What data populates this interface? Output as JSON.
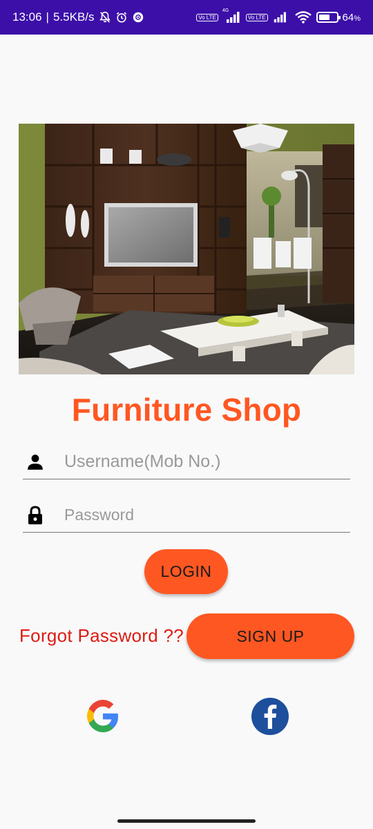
{
  "status_bar": {
    "time": "13:06",
    "network_speed": "5.5KB/s",
    "battery": "64",
    "battery_unit": "%",
    "battery_level": 0.64,
    "volte_label": "Vo LTE",
    "network_type": "4G",
    "icons": [
      "mute-icon",
      "alarm-icon",
      "app-notification-icon",
      "volte-icon",
      "signal-icon",
      "wifi-icon",
      "battery-icon"
    ]
  },
  "hero": {
    "image": "living-room-furniture-photo"
  },
  "app_title": "Furniture Shop",
  "login_form": {
    "username_placeholder": "Username(Mob No.)",
    "password_placeholder": "Password",
    "login_label": "LOGIN",
    "forgot_label": "Forgot Password ??",
    "signup_label": "SIGN UP"
  },
  "social": {
    "google_icon": "google-icon",
    "facebook_icon": "facebook-icon"
  },
  "colors": {
    "accent": "#ff5722",
    "forgot_text": "#dd1c12",
    "status_bar": "#3c0fa8",
    "background": "#f9f9fa"
  }
}
